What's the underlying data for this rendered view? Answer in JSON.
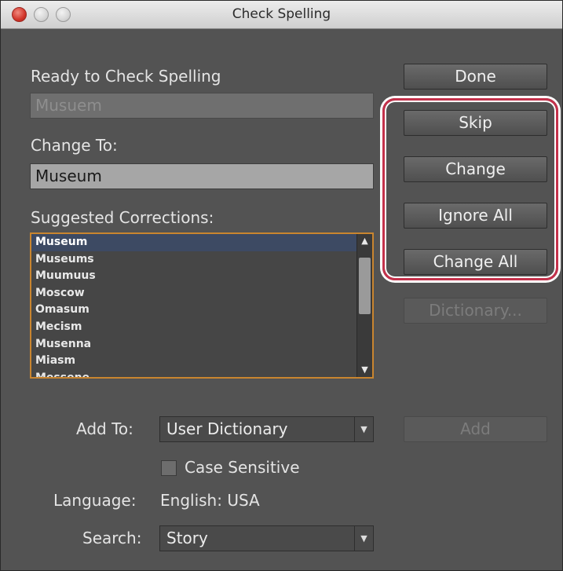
{
  "window": {
    "title": "Check Spelling"
  },
  "status_label": "Ready to Check Spelling",
  "not_in_dictionary": "Musuem",
  "change_to": {
    "label": "Change To:",
    "value": "Museum"
  },
  "suggestions": {
    "label": "Suggested Corrections:",
    "items": [
      "Museum",
      "Museums",
      "Muumuus",
      "Moscow",
      "Omasum",
      "Mecism",
      "Musenna",
      "Miasm",
      "Messene"
    ],
    "selected": "Museum"
  },
  "buttons": {
    "done": "Done",
    "skip": "Skip",
    "change": "Change",
    "ignore_all": "Ignore All",
    "change_all": "Change All",
    "dictionary": "Dictionary...",
    "add": "Add"
  },
  "add_to": {
    "label": "Add To:",
    "value": "User Dictionary"
  },
  "case_sensitive": {
    "label": "Case Sensitive",
    "checked": false
  },
  "language": {
    "label": "Language:",
    "value": "English: USA"
  },
  "search": {
    "label": "Search:",
    "value": "Story"
  },
  "colors": {
    "panel": "#535353",
    "list_border": "#c9852f",
    "highlight_ring": "#c4314b",
    "selection": "#3d4a63"
  }
}
